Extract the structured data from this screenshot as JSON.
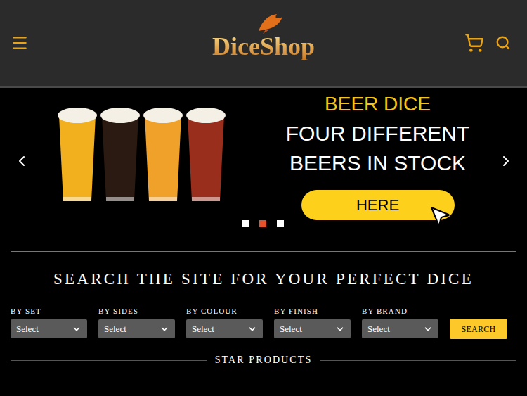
{
  "header": {
    "logo": "DiceShop"
  },
  "banner": {
    "title": "BEER DICE",
    "lines": [
      "FOUR DIFFERENT",
      "BEERS IN STOCK"
    ],
    "button": "HERE",
    "glasses": [
      {
        "color": "#f2b01e"
      },
      {
        "color": "#2a1a12"
      },
      {
        "color": "#f0a12a"
      },
      {
        "color": "#9a2e1c"
      }
    ],
    "dots": [
      {
        "selected": false
      },
      {
        "selected": true
      },
      {
        "selected": false
      }
    ]
  },
  "search": {
    "heading": "SEARCH THE SITE FOR YOUR PERFECT DICE",
    "filters": [
      {
        "label": "BY SET",
        "value": "Select"
      },
      {
        "label": "BY SIDES",
        "value": "Select"
      },
      {
        "label": "BY COLOUR",
        "value": "Select"
      },
      {
        "label": "BY FINISH",
        "value": "Select"
      },
      {
        "label": "BY BRAND",
        "value": "Select"
      }
    ],
    "button": "SEARCH"
  },
  "section": {
    "title": "STAR PRODUCTS"
  }
}
